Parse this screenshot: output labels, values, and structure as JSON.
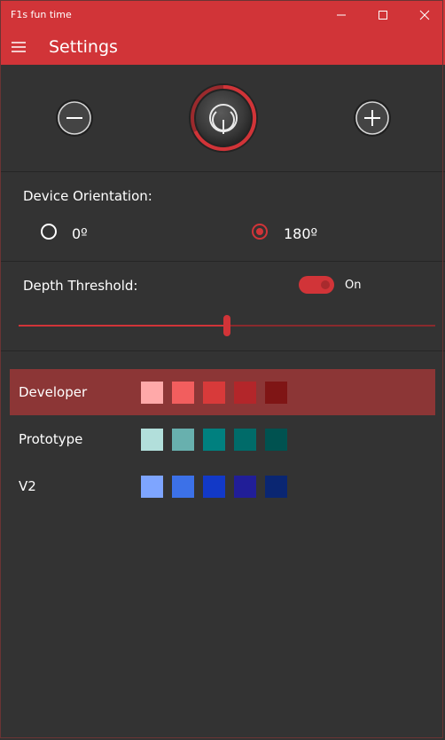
{
  "window": {
    "title": "F1s fun time"
  },
  "appbar": {
    "title": "Settings"
  },
  "orientation": {
    "label": "Device Orientation:",
    "options": [
      {
        "label": "0º",
        "selected": false
      },
      {
        "label": "180º",
        "selected": true
      }
    ]
  },
  "depth": {
    "label": "Depth Threshold:",
    "toggle_state": "On",
    "slider_value_fraction": 0.5
  },
  "themes": [
    {
      "name": "Developer",
      "selected": true,
      "colors": [
        "#ffa9a9",
        "#f25e5e",
        "#d83a3a",
        "#b3262a",
        "#7f1515"
      ]
    },
    {
      "name": "Prototype",
      "selected": false,
      "colors": [
        "#b2dfdb",
        "#68b0ae",
        "#00807f",
        "#006b69",
        "#005250"
      ]
    },
    {
      "name": "V2",
      "selected": false,
      "colors": [
        "#7ea5ff",
        "#3c71e8",
        "#1239c7",
        "#211e98",
        "#0a2672"
      ]
    }
  ],
  "colors": {
    "accent": "#d13438",
    "background": "#333333"
  },
  "icons": {
    "minus": "minus-circle-icon",
    "power": "power-icon",
    "plus": "plus-circle-icon",
    "menu": "hamburger-menu-icon"
  }
}
